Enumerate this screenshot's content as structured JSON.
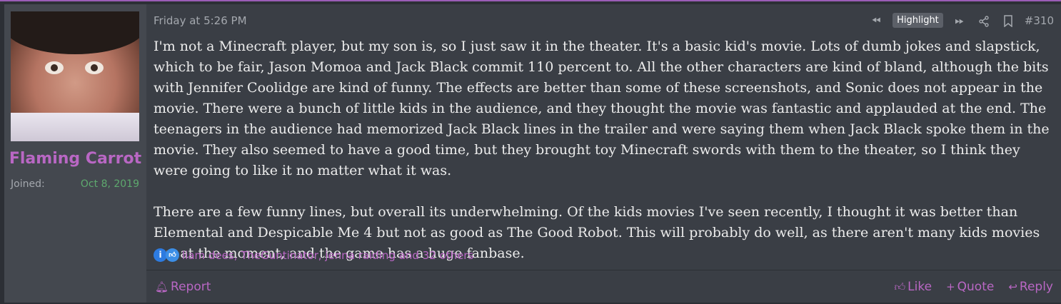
{
  "user": {
    "name": "Flaming Carrot",
    "joined_label": "Joined:",
    "joined_value": "Oct 8, 2019"
  },
  "post": {
    "date": "Friday at 5:26 PM",
    "highlight_label": "Highlight",
    "number": "#310",
    "paragraphs": [
      "I'm not a Minecraft player, but my son is, so I just saw it in the theater. It's a basic kid's movie. Lots of dumb jokes and slapstick, which to be fair, Jason Momoa and Jack Black commit 110 percent to. All the other characters are kind of bland, although the bits with Jennifer Coolidge are kind of funny. The effects are better than some of these screenshots, and Sonic does not appear in the movie. There were a bunch of little kids in the audience, and they thought the movie was fantastic and applauded at the end. The teenagers in the audience had memorized Jack Black lines in the trailer and were saying them when Jack Black spoke them in the movie. They also seemed to have a good time, but they brought toy Minecraft swords with them to the theater, so I think they were going to like it no matter what it was.",
      "There are a few funny lines, but overall its underwhelming. Of the kids movies I've seen recently, I thought it was better than Elemental and Despicable Me 4 but not as good as The Good Robot. This will probably do well, as there aren't many kids movies out at the moment, and the game has a huge fanbase."
    ],
    "reactions_text": "liam dees, TheGuntinator, jenna raiding and 32 others"
  },
  "footer": {
    "report": "Report",
    "like": "Like",
    "quote": "Quote",
    "reply": "Reply"
  },
  "icons": [
    "rewind-icon",
    "fast-forward-icon",
    "share-icon",
    "bookmark-icon",
    "informative-reaction-icon",
    "like-reaction-icon",
    "bell-icon",
    "thumbs-up-icon",
    "plus-icon",
    "reply-arrow-icon"
  ],
  "colors": {
    "accent": "#b967c4",
    "joined_date": "#5ea96e",
    "post_bg": "#3a3e45",
    "user_bg": "#44484f"
  }
}
